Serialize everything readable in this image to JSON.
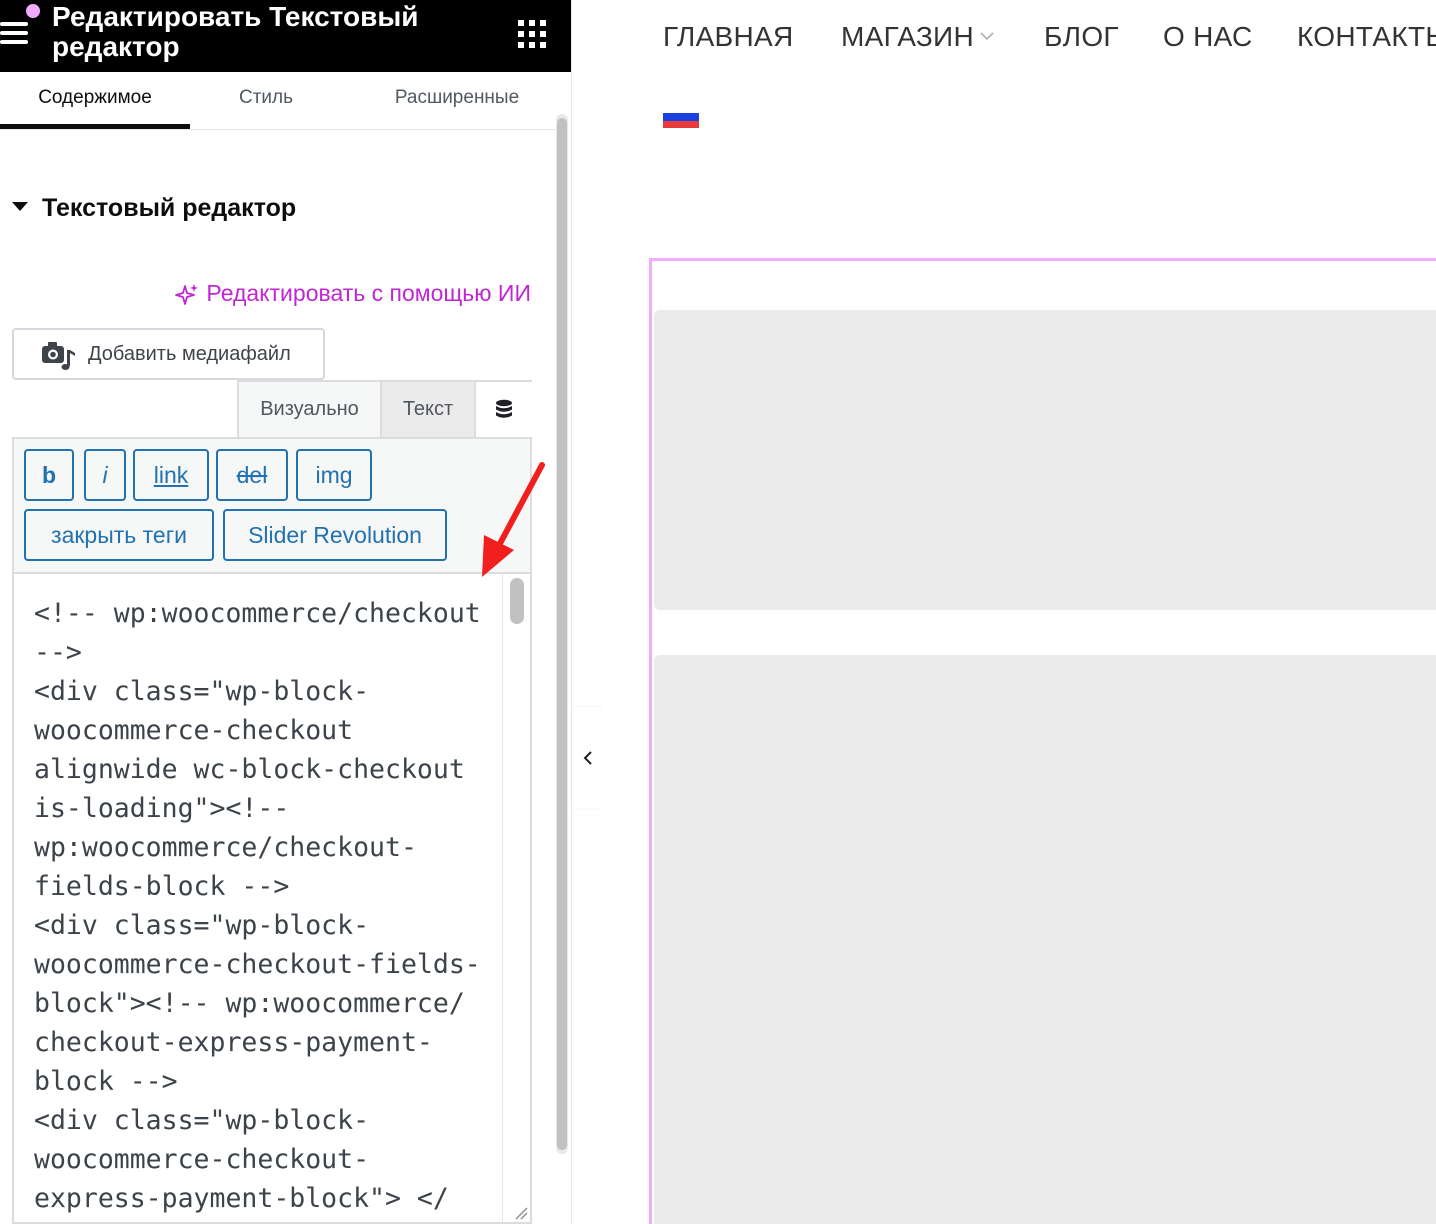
{
  "panel": {
    "title": "Редактировать Текстовый редактор",
    "accent_color": "#f0abfc",
    "tabs": [
      {
        "label": "Содержимое",
        "active": true
      },
      {
        "label": "Стиль",
        "active": false
      },
      {
        "label": "Расширенные",
        "active": false
      }
    ],
    "section_heading": "Текстовый редактор",
    "ai_link": "Редактировать с помощью ИИ",
    "ai_color": "#c026d3",
    "add_media_label": "Добавить медиафайл",
    "mode_tabs": {
      "visual": "Визуально",
      "text": "Текст"
    },
    "quicktags": [
      "b",
      "i",
      "link",
      "del",
      "img",
      "закрыть теги",
      "Slider Revolution"
    ],
    "code_lines": [
      "<!-- wp:woocommerce/checkout",
      "-->",
      "<div class=\"wp-block-",
      "woocommerce-checkout",
      "alignwide wc-block-checkout",
      "is-loading\"><!--",
      "wp:woocommerce/checkout-",
      "fields-block -->",
      "<div class=\"wp-block-",
      "woocommerce-checkout-fields-",
      "block\"><!-- wp:woocommerce/",
      "checkout-express-payment-",
      "block -->",
      "<div class=\"wp-block-",
      "woocommerce-checkout-",
      "express-payment-block\"> </"
    ]
  },
  "preview": {
    "nav": [
      "ГЛАВНАЯ",
      "МАГАЗИН",
      "БЛОГ",
      "О НАС",
      "КОНТАКТЫ"
    ],
    "flag_icon": "russia-flag-icon",
    "flag_colors": [
      "#ffffff",
      "#1c3fe0",
      "#e83a3a"
    ]
  }
}
